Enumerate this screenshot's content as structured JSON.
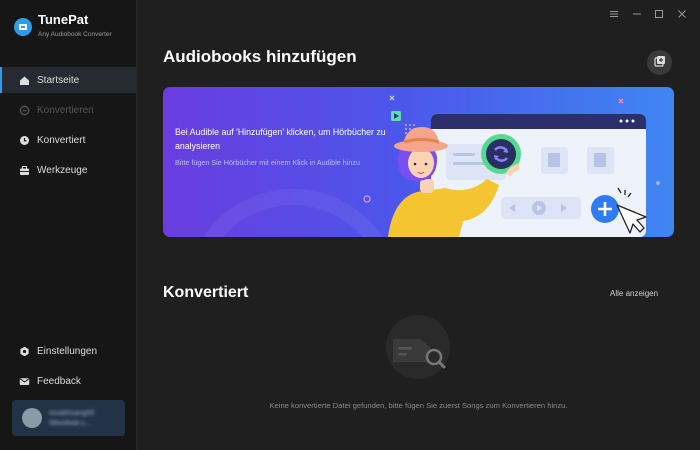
{
  "app": {
    "title": "TunePat",
    "subtitle": "Any Audiobook Converter"
  },
  "sidebar": {
    "items": [
      {
        "label": "Startseite",
        "icon": "home-icon",
        "state": "active"
      },
      {
        "label": "Konvertieren",
        "icon": "convert-icon",
        "state": "disabled"
      },
      {
        "label": "Konvertiert",
        "icon": "clock-icon",
        "state": "normal"
      },
      {
        "label": "Werkzeuge",
        "icon": "toolbox-icon",
        "state": "normal"
      }
    ],
    "bottom_items": [
      {
        "label": "Einstellungen",
        "icon": "gear-icon"
      },
      {
        "label": "Feedback",
        "icon": "mail-icon"
      }
    ],
    "user": {
      "line1": "nicolehuang55",
      "line2": "58outlook.c..."
    }
  },
  "window_controls": [
    "menu-icon",
    "minimize-icon",
    "maximize-icon",
    "close-icon"
  ],
  "main": {
    "title": "Audiobooks hinzufügen",
    "banner": {
      "text": "Bei Audible auf 'Hinzufügen' klicken, um Hörbücher zu analysieren",
      "subtext": "Bitte fügen Sie Hörbücher mit einem Klick in Audible hinzu",
      "colors": {
        "from": "#6a3de0",
        "to": "#3f86f1"
      }
    },
    "converted": {
      "title": "Konvertiert",
      "show_all": "Alle anzeigen",
      "empty_message": "Keine konvertierte Datei gefunden, bitte fügen Sie zuerst Songs zum Konvertieren hinzu."
    }
  },
  "colors": {
    "accent": "#2f9be8",
    "sidebar": "#161616",
    "main": "#1f1f1f"
  }
}
